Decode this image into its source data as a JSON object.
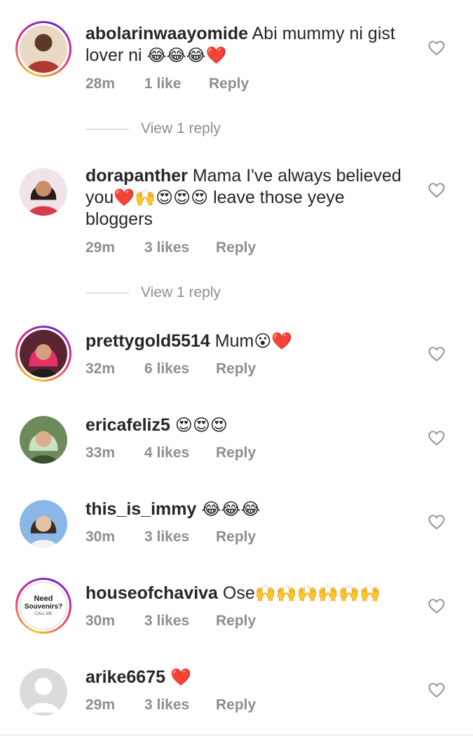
{
  "comments": [
    {
      "username": "abolarinwaayomide",
      "text": "Abi mummy ni gist lover ni",
      "emoji": "😂😂😂❤️",
      "time": "28m",
      "likes": "1 like",
      "reply": "Reply",
      "view_replies": "View 1 reply"
    },
    {
      "username": "dorapanther",
      "text_a": "Mama I've always believed you",
      "emoji_a": "❤️🙌😍😍😍",
      "text_b": "leave those yeye bloggers",
      "time": "29m",
      "likes": "3 likes",
      "reply": "Reply",
      "view_replies": "View 1 reply"
    },
    {
      "username": "prettygold5514",
      "text": "Mum",
      "emoji": "😮❤️",
      "time": "32m",
      "likes": "6 likes",
      "reply": "Reply"
    },
    {
      "username": "ericafeliz5",
      "text": "",
      "emoji": "😍😍😍",
      "time": "33m",
      "likes": "4 likes",
      "reply": "Reply"
    },
    {
      "username": "this_is_immy",
      "text": "",
      "emoji": "😂😂😂",
      "time": "30m",
      "likes": "3 likes",
      "reply": "Reply"
    },
    {
      "username": "houseofchaviva",
      "text": "Ose",
      "emoji": "🙌🙌🙌🙌🙌🙌",
      "time": "30m",
      "likes": "3 likes",
      "reply": "Reply",
      "avatar_text": [
        "Need",
        "Souvenirs?",
        "CALL ME"
      ]
    },
    {
      "username": "arike6675",
      "text": "",
      "emoji": "❤️",
      "time": "29m",
      "likes": "3 likes",
      "reply": "Reply"
    }
  ],
  "icons": {
    "like": "heart-outline-icon"
  },
  "colors": {
    "meta": "#8e8e8e",
    "text": "#262626",
    "heart_outline": "#8e8e8e"
  }
}
